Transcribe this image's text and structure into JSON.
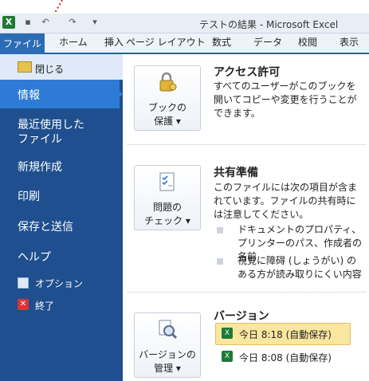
{
  "window": {
    "app_icon": "X",
    "title": "テストの結果 - Microsoft Excel"
  },
  "tabs": {
    "file": "ファイル",
    "home": "ホーム",
    "insert": "挿入",
    "page_layout": "ページ レイアウト",
    "formulas": "数式",
    "data": "データ",
    "review": "校閲",
    "view": "表示"
  },
  "nav": {
    "close": "閉じる",
    "info": "情報",
    "recent_line1": "最近使用した",
    "recent_line2": "ファイル",
    "new": "新規作成",
    "print": "印刷",
    "save_send": "保存と送信",
    "help": "ヘルプ",
    "options": "オプション",
    "exit": "終了"
  },
  "permissions": {
    "button_line1": "ブックの",
    "button_line2": "保護 ▾",
    "title": "アクセス許可",
    "desc": "すべてのユーザーがこのブックを開いてコピーや変更を行うことができます。"
  },
  "prepare": {
    "button_line1": "問題の",
    "button_line2": "チェック ▾",
    "title": "共有準備",
    "desc": "このファイルには次の項目が含まれています。ファイルの共有時には注意してください。",
    "bullet1": "ドキュメントのプロパティ、プリンターのパス、作成者の名前",
    "bullet2": "視覚に障碍 (しょうがい) のある方が読み取りにくい内容"
  },
  "versions": {
    "button_line1": "バージョンの",
    "button_line2": "管理 ▾",
    "title": "バージョン",
    "version1": "今日 8:18 (自動保存)",
    "version2": "今日 8:08 (自動保存)"
  },
  "icons": {
    "lock": "lock-icon",
    "checklist": "checklist-icon",
    "magnifier": "magnifier-icon"
  }
}
